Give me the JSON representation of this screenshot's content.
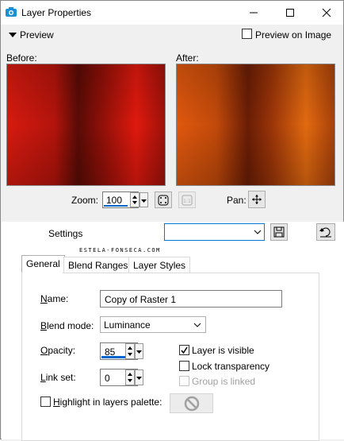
{
  "window": {
    "title": "Layer Properties"
  },
  "preview": {
    "toggle_label": "Preview",
    "preview_on_image_label": "Preview on Image",
    "preview_on_image_checked": false,
    "before_label": "Before:",
    "after_label": "After:",
    "zoom_label": "Zoom:",
    "zoom_value": "100",
    "pan_label": "Pan:"
  },
  "settings": {
    "label": "Settings",
    "value": ""
  },
  "watermark": "ESTELA-FONSECA.COM",
  "tabs": [
    {
      "label": "General",
      "active": true
    },
    {
      "label": "Blend Ranges",
      "active": false
    },
    {
      "label": "Layer Styles",
      "active": false
    }
  ],
  "general": {
    "name_label": "Name:",
    "name_value": "Copy of Raster 1",
    "blend_mode_label": "Blend mode:",
    "blend_mode_value": "Luminance",
    "opacity_label": "Opacity:",
    "opacity_value": "85",
    "link_set_label": "Link set:",
    "link_set_value": "0",
    "layer_visible_label": "Layer is visible",
    "layer_visible_checked": true,
    "lock_transparency_label": "Lock transparency",
    "lock_transparency_checked": false,
    "group_is_linked_label": "Group is linked",
    "group_is_linked_checked": false,
    "highlight_label": "Highlight in layers palette:",
    "highlight_checked": false
  },
  "colors": {
    "accent": "#0066cc"
  }
}
